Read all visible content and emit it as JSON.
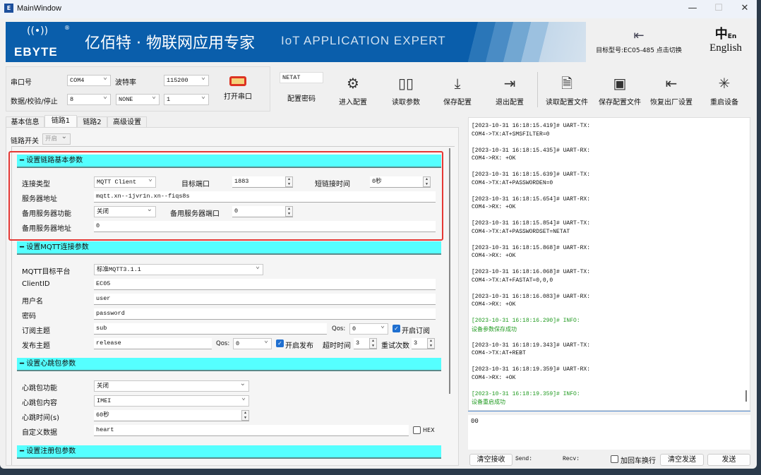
{
  "window": {
    "title": "MainWindow",
    "app_icon": "EBYTE",
    "controls": [
      "minimize",
      "maximize",
      "close"
    ]
  },
  "banner": {
    "logo": "EBYTE",
    "slogan_cn": "亿佰特 · 物联网应用专家",
    "slogan_en": "IoT APPLICATION EXPERT"
  },
  "header_right": {
    "target_model": "目标型号:EC05-485 点击切换",
    "language": "English"
  },
  "serial": {
    "port_label": "串口号",
    "port": "COM4",
    "baud_label": "波特率",
    "baud": "115200",
    "dps_label": "数据/校验/停止",
    "data_bits": "8",
    "parity": "NONE",
    "stop_bits": "1",
    "open_label": "打开串口"
  },
  "password": {
    "value": "NETAT",
    "label": "配置密码"
  },
  "toolbar": [
    {
      "label": "进入配置",
      "icon": "gear-icon"
    },
    {
      "label": "读取参数",
      "icon": "book-icon"
    },
    {
      "label": "保存配置",
      "icon": "download-icon"
    },
    {
      "label": "退出配置",
      "icon": "exit-icon"
    },
    {
      "label": "读取配置文件",
      "icon": "document-icon"
    },
    {
      "label": "保存配置文件",
      "icon": "save-icon"
    },
    {
      "label": "恢复出厂设置",
      "icon": "restore-icon"
    },
    {
      "label": "重启设备",
      "icon": "loading-icon"
    }
  ],
  "tabs": [
    {
      "label": "基本信息"
    },
    {
      "label": "链路1",
      "active": true
    },
    {
      "label": "链路2"
    },
    {
      "label": "高级设置"
    }
  ],
  "link_switch": {
    "label": "链路开关",
    "value": "开启"
  },
  "sec1": {
    "title": "设置链路基本参数",
    "conn_type_label": "连接类型",
    "conn_type": "MQTT Client",
    "target_port_label": "目标端口",
    "target_port": "1883",
    "short_label": "短链接时间",
    "short": "0秒",
    "server_label": "服务器地址",
    "server": "mqtt.xn--1jvr1n.xn--fiqs8s",
    "backup_func_label": "备用服务器功能",
    "backup_func": "关闭",
    "backup_port_label": "备用服务器端口",
    "backup_port": "0",
    "backup_addr_label": "备用服务器地址",
    "backup_addr": "0"
  },
  "sec2": {
    "title": "设置MQTT连接参数",
    "platform_label": "MQTT目标平台",
    "platform": "标准MQTT3.1.1",
    "client_label": "ClientID",
    "client": "EC05",
    "user_label": "用户名",
    "user": "user",
    "pwd_label": "密码",
    "pwd": "password",
    "sub_label": "订阅主题",
    "sub": "sub",
    "qos_label": "Qos:",
    "sub_qos": "0",
    "sub_enable": "开启订阅",
    "pub_label": "发布主题",
    "pub": "release",
    "pub_qos": "0",
    "pub_enable": "开启发布",
    "timeout_label": "超时时间",
    "timeout": "3",
    "retry_label": "重试次数",
    "retry": "3"
  },
  "sec3": {
    "title": "设置心跳包参数",
    "func_label": "心跳包功能",
    "func": "关闭",
    "content_label": "心跳包内容",
    "content": "IMEI",
    "time_label": "心跳时间(s)",
    "time": "60秒",
    "custom_label": "自定义数据",
    "custom": "heart",
    "hex_label": "HEX"
  },
  "sec4": {
    "title": "设置注册包参数"
  },
  "log": [
    {
      "t": "[2023-10-31 16:18:15.419]# UART-TX:",
      "m": "COM4->TX:AT+SMSFILTER=0"
    },
    {
      "t": "[2023-10-31 16:18:15.435]# UART-RX:",
      "m": "COM4->RX: +OK"
    },
    {
      "t": "[2023-10-31 16:18:15.639]# UART-TX:",
      "m": "COM4->TX:AT+PASSWORDEN=0"
    },
    {
      "t": "[2023-10-31 16:18:15.654]# UART-RX:",
      "m": "COM4->RX: +OK"
    },
    {
      "t": "[2023-10-31 16:18:15.854]# UART-TX:",
      "m": "COM4->TX:AT+PASSWORDSET=NETAT"
    },
    {
      "t": "[2023-10-31 16:18:15.868]# UART-RX:",
      "m": "COM4->RX: +OK"
    },
    {
      "t": "[2023-10-31 16:18:16.068]# UART-TX:",
      "m": "COM4->TX:AT+FASTAT=0,0,0"
    },
    {
      "t": "[2023-10-31 16:18:16.083]# UART-RX:",
      "m": "COM4->RX: +OK"
    },
    {
      "t": "[2023-10-31 16:18:16.290]# INFO:",
      "m": "设备参数保存成功",
      "info": true
    },
    {
      "t": "[2023-10-31 16:18:19.343]# UART-TX:",
      "m": "COM4->TX:AT+REBT"
    },
    {
      "t": "[2023-10-31 16:18:19.359]# UART-RX:",
      "m": "COM4->RX: +OK"
    },
    {
      "t": "[2023-10-31 16:18:19.359]# INFO:",
      "m": "设备重启成功",
      "info": true
    }
  ],
  "send_area": {
    "value": "00"
  },
  "bottom": {
    "clear_recv": "清空接收",
    "send_count": "Send:",
    "recv_count": "Recv:",
    "crlf": "加回车换行",
    "clear_send": "清空发送",
    "send": "发送"
  },
  "colors": {
    "section": "#55ffff",
    "banner": "#0a5eab",
    "highlight": "#e53935",
    "info": "#1f9a1f"
  }
}
